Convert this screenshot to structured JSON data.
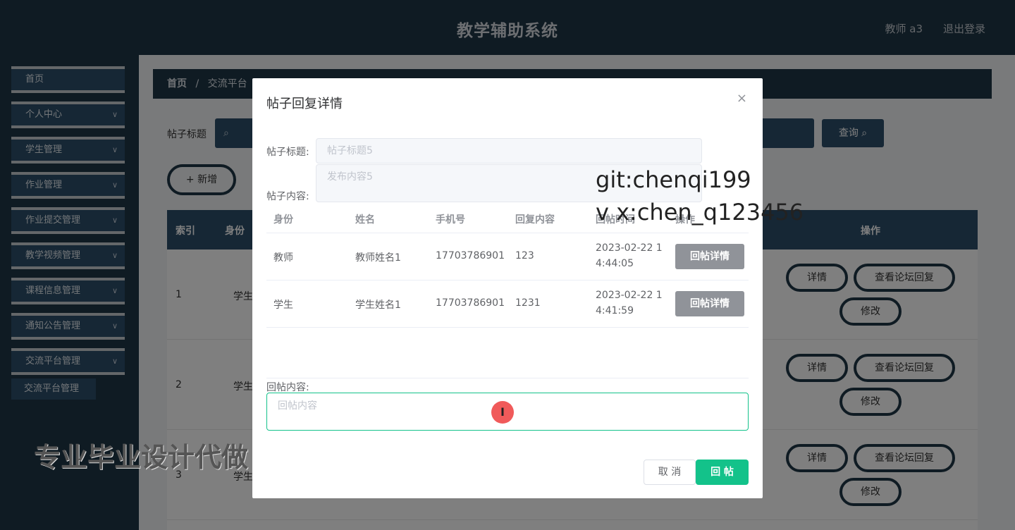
{
  "header": {
    "title": "教学辅助系统",
    "user": "教师 a3",
    "logout": "退出登录"
  },
  "sidebar": {
    "items": [
      {
        "label": "首页"
      },
      {
        "label": "个人中心"
      },
      {
        "label": "学生管理"
      },
      {
        "label": "作业管理"
      },
      {
        "label": "作业提交管理"
      },
      {
        "label": "教学视频管理"
      },
      {
        "label": "课程信息管理"
      },
      {
        "label": "通知公告管理"
      },
      {
        "label": "交流平台管理"
      }
    ],
    "sub_item": "交流平台管理",
    "chevron": "∨"
  },
  "main": {
    "breadcrumb_home": "首页",
    "breadcrumb_sep": "/",
    "breadcrumb_current": "交流平台",
    "search_label": "帖子标题",
    "search_icon": "search-icon",
    "query_label": "查询",
    "add_label": "+ 新增",
    "table_head": {
      "index": "索引",
      "role": "身份",
      "actions": "操作"
    },
    "rows": [
      {
        "index": "1",
        "role": "学生"
      },
      {
        "index": "2",
        "role": "学生"
      },
      {
        "index": "3",
        "role": "学生"
      }
    ],
    "actions": {
      "detail": "详情",
      "view_replies": "查看论坛回复",
      "edit": "修改"
    }
  },
  "dialog": {
    "title": "帖子回复详情",
    "close": "×",
    "title_label": "帖子标题:",
    "title_value": "帖子标题5",
    "content_label": "帖子内容:",
    "content_value": "发布内容5",
    "columns": [
      "身份",
      "姓名",
      "手机号",
      "回复内容",
      "回帖时间",
      "操作"
    ],
    "replies": [
      {
        "role": "教师",
        "name": "教师姓名1",
        "phone": "17703786901",
        "content": "123",
        "time_l1": "2023-02-22 1",
        "time_l2": "4:44:05",
        "btn": "回帖详情"
      },
      {
        "role": "学生",
        "name": "学生姓名1",
        "phone": "17703786901",
        "content": "1231",
        "time_l1": "2023-02-22 1",
        "time_l2": "4:41:59",
        "btn": "回帖详情"
      }
    ],
    "reply_label": "回帖内容:",
    "reply_placeholder": "回帖内容",
    "cancel": "取 消",
    "submit": "回 帖",
    "cursor_glyph": "I"
  },
  "watermarks": {
    "git": "git:chenqi199",
    "vx": "v x:chen_q123456",
    "promo": "专业毕业设计代做"
  },
  "colors": {
    "header": "#1f3646",
    "nav": "#2d4e6b",
    "accent": "#13c28a",
    "muted_button": "#909399"
  }
}
